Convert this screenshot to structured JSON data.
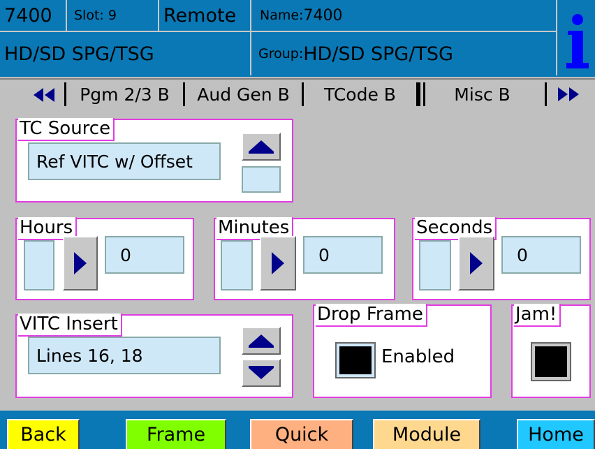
{
  "header": {
    "model": "7400",
    "slot": "Slot: 9",
    "mode": "Remote",
    "name_label": "Name:",
    "name_value": "7400",
    "desc": "HD/SD SPG/TSG",
    "group_label": "Group:",
    "group_value": "HD/SD SPG/TSG",
    "info_icon": "info-i-icon"
  },
  "tabs": {
    "prev_icon": "double-left-arrow-icon",
    "next_icon": "double-right-arrow-icon",
    "items": [
      {
        "label": "Pgm 2/3 B"
      },
      {
        "label": "Aud Gen B"
      },
      {
        "label": "TCode B"
      },
      {
        "label": "Misc B"
      }
    ],
    "active_index": 2
  },
  "tc_source": {
    "title": "TC Source",
    "value": "Ref VITC w/ Offset",
    "up_icon": "up-arrow-icon"
  },
  "hours": {
    "title": "Hours",
    "value": "0",
    "right_icon": "right-arrow-icon"
  },
  "minutes": {
    "title": "Minutes",
    "value": "0",
    "right_icon": "right-arrow-icon"
  },
  "seconds": {
    "title": "Seconds",
    "value": "0",
    "right_icon": "right-arrow-icon"
  },
  "vitc_insert": {
    "title": "VITC Insert",
    "value": "Lines 16, 18",
    "up_icon": "up-arrow-icon",
    "down_icon": "down-arrow-icon"
  },
  "drop_frame": {
    "title": "Drop Frame",
    "checkbox_label": "Enabled"
  },
  "jam": {
    "title": "Jam!"
  },
  "bottom": {
    "back": "Back",
    "frame": "Frame",
    "quick": "Quick",
    "module": "Module",
    "home": "Home"
  },
  "colors": {
    "header_bg": "#0a78b4",
    "panel_border": "#e23ce2",
    "field_bg": "#cfe8f8",
    "back_btn": "#ffff00",
    "frame_btn": "#80ff00",
    "quick_btn": "#ffb080",
    "module_btn": "#ffd890",
    "home_btn": "#20c8ff"
  }
}
